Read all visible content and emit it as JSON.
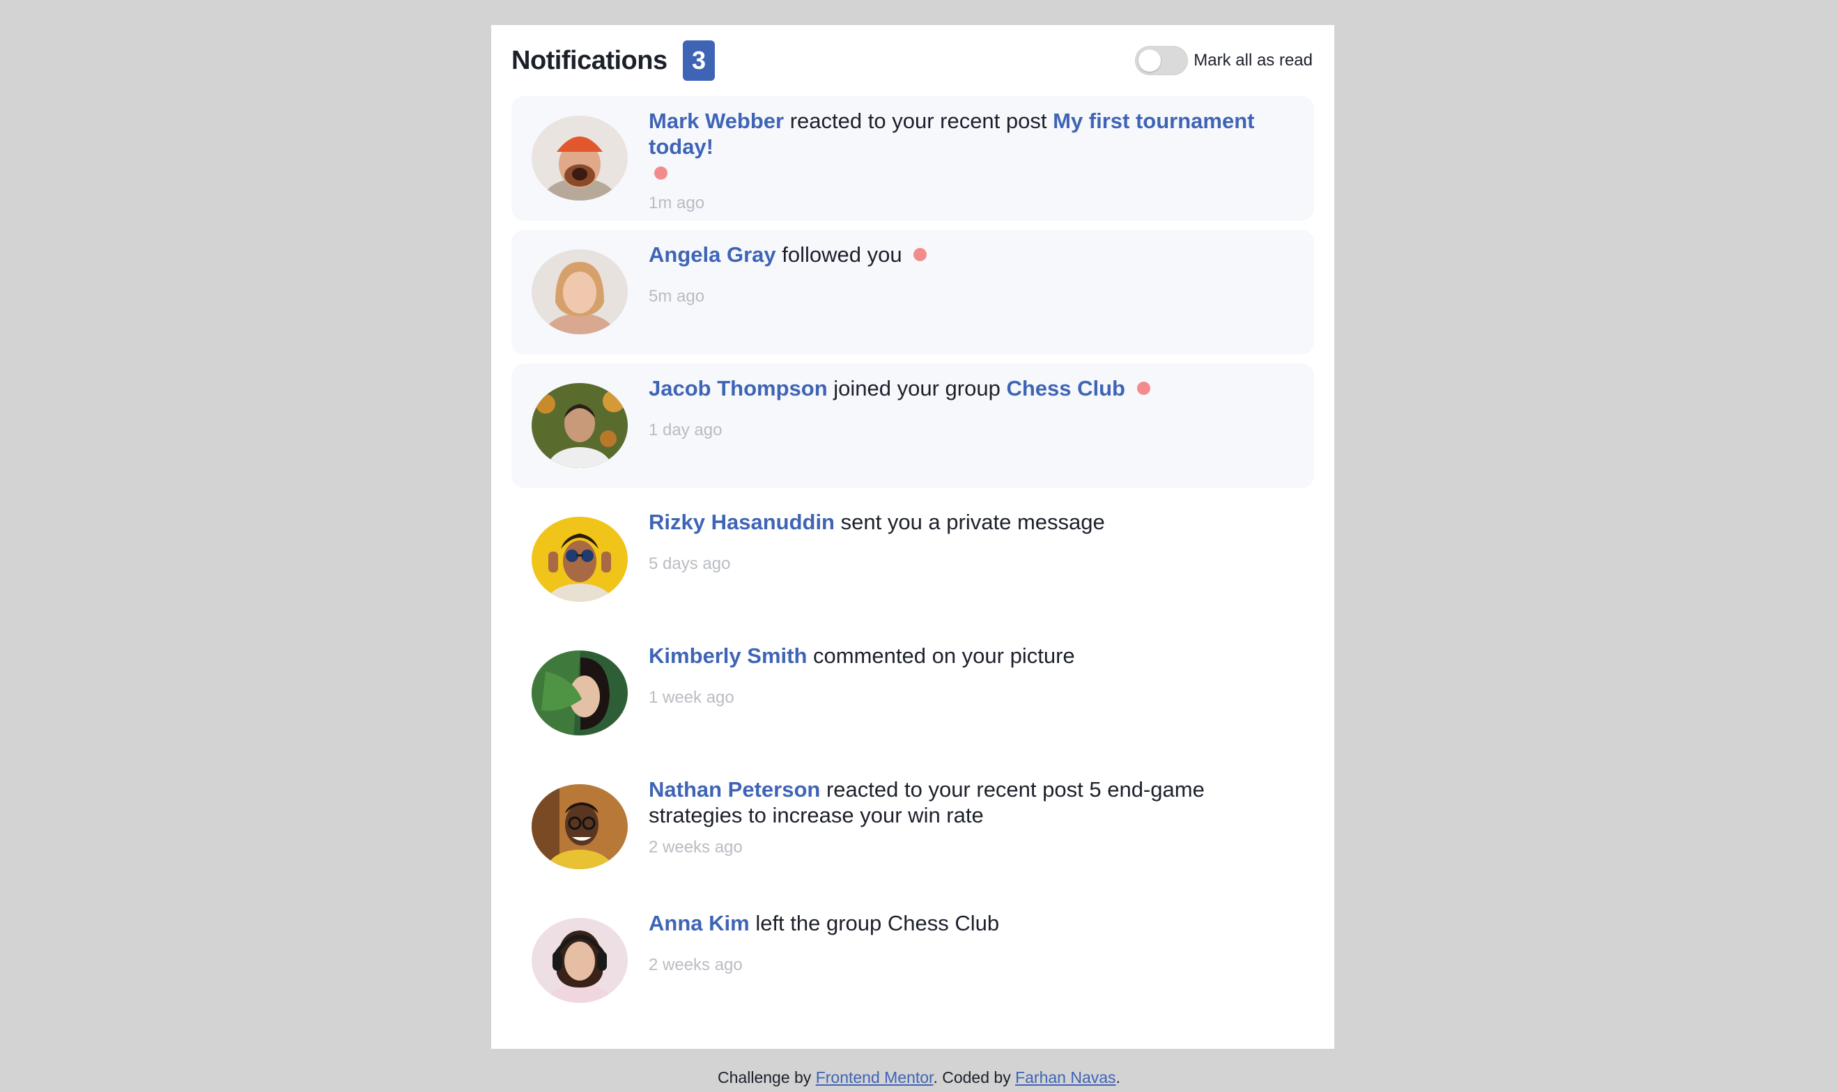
{
  "header": {
    "title": "Notifications",
    "unread_count": "3",
    "mark_all_label": "Mark all as read",
    "mark_all_enabled": false
  },
  "notifications": [
    {
      "user": "Mark Webber",
      "action": "reacted to your recent post",
      "target": "My first tournament today!",
      "target_style": "link",
      "time": "1m ago",
      "unread": true,
      "dot_on_new_line": true,
      "avatar": "mark-webber-avatar"
    },
    {
      "user": "Angela Gray",
      "action": "followed you",
      "target": "",
      "target_style": "none",
      "time": "5m ago",
      "unread": true,
      "dot_on_new_line": false,
      "avatar": "angela-gray-avatar"
    },
    {
      "user": "Jacob Thompson",
      "action": "joined your group",
      "target": "Chess Club",
      "target_style": "link",
      "time": "1 day ago",
      "unread": true,
      "dot_on_new_line": false,
      "avatar": "jacob-thompson-avatar"
    },
    {
      "user": "Rizky Hasanuddin",
      "action": "sent you a private message",
      "target": "",
      "target_style": "none",
      "time": "5 days ago",
      "unread": false,
      "dot_on_new_line": false,
      "avatar": "rizky-hasanuddin-avatar"
    },
    {
      "user": "Kimberly Smith",
      "action": "commented on your picture",
      "target": "",
      "target_style": "none",
      "time": "1 week ago",
      "unread": false,
      "dot_on_new_line": false,
      "avatar": "kimberly-smith-avatar"
    },
    {
      "user": "Nathan Peterson",
      "action": "reacted to your recent post",
      "target": "5 end-game strategies to increase your win rate",
      "target_style": "plain",
      "time": "2 weeks ago",
      "unread": false,
      "dot_on_new_line": false,
      "avatar": "nathan-peterson-avatar"
    },
    {
      "user": "Anna Kim",
      "action": "left the group",
      "target": "Chess Club",
      "target_style": "plain",
      "time": "2 weeks ago",
      "unread": false,
      "dot_on_new_line": false,
      "avatar": "anna-kim-avatar"
    }
  ],
  "footer": {
    "prefix": "Challenge by",
    "link1": "Frontend Mentor",
    "middle": ". Coded by",
    "link2": "Farhan Navas",
    "suffix": "."
  },
  "colors": {
    "accent": "#3f64b5",
    "unread_bg": "#f6f8fc",
    "dot": "#f28c8c",
    "page_bg": "#d3d3d3",
    "muted_text": "#b9bcc3"
  }
}
